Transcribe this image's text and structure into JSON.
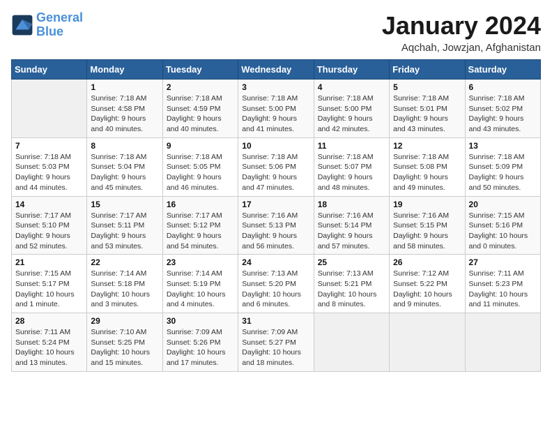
{
  "logo": {
    "line1": "General",
    "line2": "Blue"
  },
  "title": "January 2024",
  "subtitle": "Aqchah, Jowzjan, Afghanistan",
  "days_of_week": [
    "Sunday",
    "Monday",
    "Tuesday",
    "Wednesday",
    "Thursday",
    "Friday",
    "Saturday"
  ],
  "weeks": [
    [
      {
        "day": "",
        "info": ""
      },
      {
        "day": "1",
        "info": "Sunrise: 7:18 AM\nSunset: 4:58 PM\nDaylight: 9 hours\nand 40 minutes."
      },
      {
        "day": "2",
        "info": "Sunrise: 7:18 AM\nSunset: 4:59 PM\nDaylight: 9 hours\nand 40 minutes."
      },
      {
        "day": "3",
        "info": "Sunrise: 7:18 AM\nSunset: 5:00 PM\nDaylight: 9 hours\nand 41 minutes."
      },
      {
        "day": "4",
        "info": "Sunrise: 7:18 AM\nSunset: 5:00 PM\nDaylight: 9 hours\nand 42 minutes."
      },
      {
        "day": "5",
        "info": "Sunrise: 7:18 AM\nSunset: 5:01 PM\nDaylight: 9 hours\nand 43 minutes."
      },
      {
        "day": "6",
        "info": "Sunrise: 7:18 AM\nSunset: 5:02 PM\nDaylight: 9 hours\nand 43 minutes."
      }
    ],
    [
      {
        "day": "7",
        "info": "Sunrise: 7:18 AM\nSunset: 5:03 PM\nDaylight: 9 hours\nand 44 minutes."
      },
      {
        "day": "8",
        "info": "Sunrise: 7:18 AM\nSunset: 5:04 PM\nDaylight: 9 hours\nand 45 minutes."
      },
      {
        "day": "9",
        "info": "Sunrise: 7:18 AM\nSunset: 5:05 PM\nDaylight: 9 hours\nand 46 minutes."
      },
      {
        "day": "10",
        "info": "Sunrise: 7:18 AM\nSunset: 5:06 PM\nDaylight: 9 hours\nand 47 minutes."
      },
      {
        "day": "11",
        "info": "Sunrise: 7:18 AM\nSunset: 5:07 PM\nDaylight: 9 hours\nand 48 minutes."
      },
      {
        "day": "12",
        "info": "Sunrise: 7:18 AM\nSunset: 5:08 PM\nDaylight: 9 hours\nand 49 minutes."
      },
      {
        "day": "13",
        "info": "Sunrise: 7:18 AM\nSunset: 5:09 PM\nDaylight: 9 hours\nand 50 minutes."
      }
    ],
    [
      {
        "day": "14",
        "info": "Sunrise: 7:17 AM\nSunset: 5:10 PM\nDaylight: 9 hours\nand 52 minutes."
      },
      {
        "day": "15",
        "info": "Sunrise: 7:17 AM\nSunset: 5:11 PM\nDaylight: 9 hours\nand 53 minutes."
      },
      {
        "day": "16",
        "info": "Sunrise: 7:17 AM\nSunset: 5:12 PM\nDaylight: 9 hours\nand 54 minutes."
      },
      {
        "day": "17",
        "info": "Sunrise: 7:16 AM\nSunset: 5:13 PM\nDaylight: 9 hours\nand 56 minutes."
      },
      {
        "day": "18",
        "info": "Sunrise: 7:16 AM\nSunset: 5:14 PM\nDaylight: 9 hours\nand 57 minutes."
      },
      {
        "day": "19",
        "info": "Sunrise: 7:16 AM\nSunset: 5:15 PM\nDaylight: 9 hours\nand 58 minutes."
      },
      {
        "day": "20",
        "info": "Sunrise: 7:15 AM\nSunset: 5:16 PM\nDaylight: 10 hours\nand 0 minutes."
      }
    ],
    [
      {
        "day": "21",
        "info": "Sunrise: 7:15 AM\nSunset: 5:17 PM\nDaylight: 10 hours\nand 1 minute."
      },
      {
        "day": "22",
        "info": "Sunrise: 7:14 AM\nSunset: 5:18 PM\nDaylight: 10 hours\nand 3 minutes."
      },
      {
        "day": "23",
        "info": "Sunrise: 7:14 AM\nSunset: 5:19 PM\nDaylight: 10 hours\nand 4 minutes."
      },
      {
        "day": "24",
        "info": "Sunrise: 7:13 AM\nSunset: 5:20 PM\nDaylight: 10 hours\nand 6 minutes."
      },
      {
        "day": "25",
        "info": "Sunrise: 7:13 AM\nSunset: 5:21 PM\nDaylight: 10 hours\nand 8 minutes."
      },
      {
        "day": "26",
        "info": "Sunrise: 7:12 AM\nSunset: 5:22 PM\nDaylight: 10 hours\nand 9 minutes."
      },
      {
        "day": "27",
        "info": "Sunrise: 7:11 AM\nSunset: 5:23 PM\nDaylight: 10 hours\nand 11 minutes."
      }
    ],
    [
      {
        "day": "28",
        "info": "Sunrise: 7:11 AM\nSunset: 5:24 PM\nDaylight: 10 hours\nand 13 minutes."
      },
      {
        "day": "29",
        "info": "Sunrise: 7:10 AM\nSunset: 5:25 PM\nDaylight: 10 hours\nand 15 minutes."
      },
      {
        "day": "30",
        "info": "Sunrise: 7:09 AM\nSunset: 5:26 PM\nDaylight: 10 hours\nand 17 minutes."
      },
      {
        "day": "31",
        "info": "Sunrise: 7:09 AM\nSunset: 5:27 PM\nDaylight: 10 hours\nand 18 minutes."
      },
      {
        "day": "",
        "info": ""
      },
      {
        "day": "",
        "info": ""
      },
      {
        "day": "",
        "info": ""
      }
    ]
  ]
}
